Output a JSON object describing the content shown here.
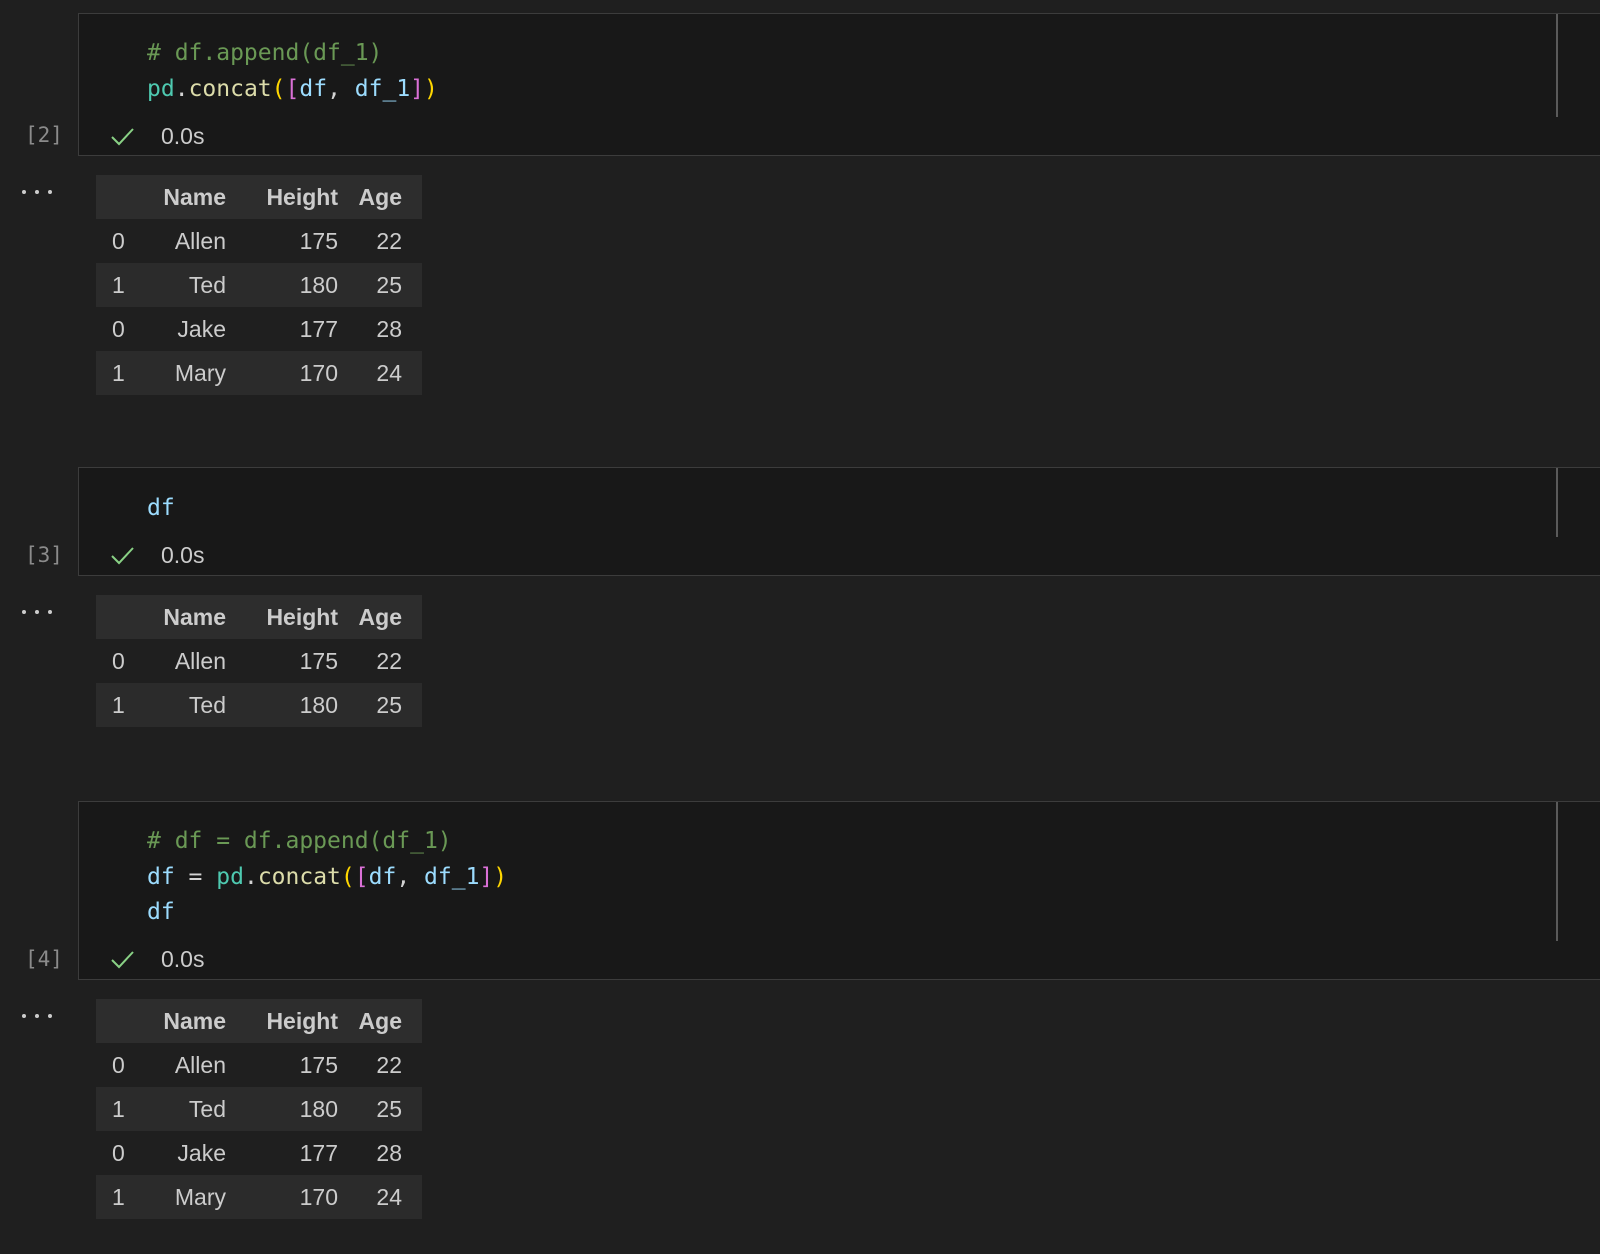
{
  "cells": [
    {
      "exec_count": "[2]",
      "status_time": "0.0s",
      "code_lines": [
        [
          {
            "t": "# df.append(df_1)",
            "c": "comment"
          }
        ],
        [
          {
            "t": "pd",
            "c": "module"
          },
          {
            "t": ".",
            "c": "punct"
          },
          {
            "t": "concat",
            "c": "func"
          },
          {
            "t": "(",
            "c": "paren"
          },
          {
            "t": "[",
            "c": "bracket"
          },
          {
            "t": "df",
            "c": "var"
          },
          {
            "t": ", ",
            "c": "punct"
          },
          {
            "t": "df_1",
            "c": "var"
          },
          {
            "t": "]",
            "c": "bracket"
          },
          {
            "t": ")",
            "c": "paren"
          }
        ]
      ],
      "output": {
        "columns": [
          "",
          "Name",
          "Height",
          "Age"
        ],
        "rows": [
          [
            "0",
            "Allen",
            "175",
            "22"
          ],
          [
            "1",
            "Ted",
            "180",
            "25"
          ],
          [
            "0",
            "Jake",
            "177",
            "28"
          ],
          [
            "1",
            "Mary",
            "170",
            "24"
          ]
        ]
      }
    },
    {
      "exec_count": "[3]",
      "status_time": "0.0s",
      "code_lines": [
        [
          {
            "t": "df",
            "c": "var"
          }
        ]
      ],
      "output": {
        "columns": [
          "",
          "Name",
          "Height",
          "Age"
        ],
        "rows": [
          [
            "0",
            "Allen",
            "175",
            "22"
          ],
          [
            "1",
            "Ted",
            "180",
            "25"
          ]
        ]
      }
    },
    {
      "exec_count": "[4]",
      "status_time": "0.0s",
      "code_lines": [
        [
          {
            "t": "# df = df.append(df_1)",
            "c": "comment"
          }
        ],
        [
          {
            "t": "df",
            "c": "var"
          },
          {
            "t": " = ",
            "c": "punct"
          },
          {
            "t": "pd",
            "c": "module"
          },
          {
            "t": ".",
            "c": "punct"
          },
          {
            "t": "concat",
            "c": "func"
          },
          {
            "t": "(",
            "c": "paren"
          },
          {
            "t": "[",
            "c": "bracket"
          },
          {
            "t": "df",
            "c": "var"
          },
          {
            "t": ", ",
            "c": "punct"
          },
          {
            "t": "df_1",
            "c": "var"
          },
          {
            "t": "]",
            "c": "bracket"
          },
          {
            "t": ")",
            "c": "paren"
          }
        ],
        [
          {
            "t": "df",
            "c": "var"
          }
        ]
      ],
      "output": {
        "columns": [
          "",
          "Name",
          "Height",
          "Age"
        ],
        "rows": [
          [
            "0",
            "Allen",
            "175",
            "22"
          ],
          [
            "1",
            "Ted",
            "180",
            "25"
          ],
          [
            "0",
            "Jake",
            "177",
            "28"
          ],
          [
            "1",
            "Mary",
            "170",
            "24"
          ]
        ]
      }
    }
  ],
  "colors": {
    "background": "#1f1f1f",
    "cell_input_bg": "#181818",
    "check": "#89d185",
    "comment": "#6a9955"
  },
  "icons": {
    "status": "check-icon",
    "output_menu": "ellipsis-icon"
  }
}
